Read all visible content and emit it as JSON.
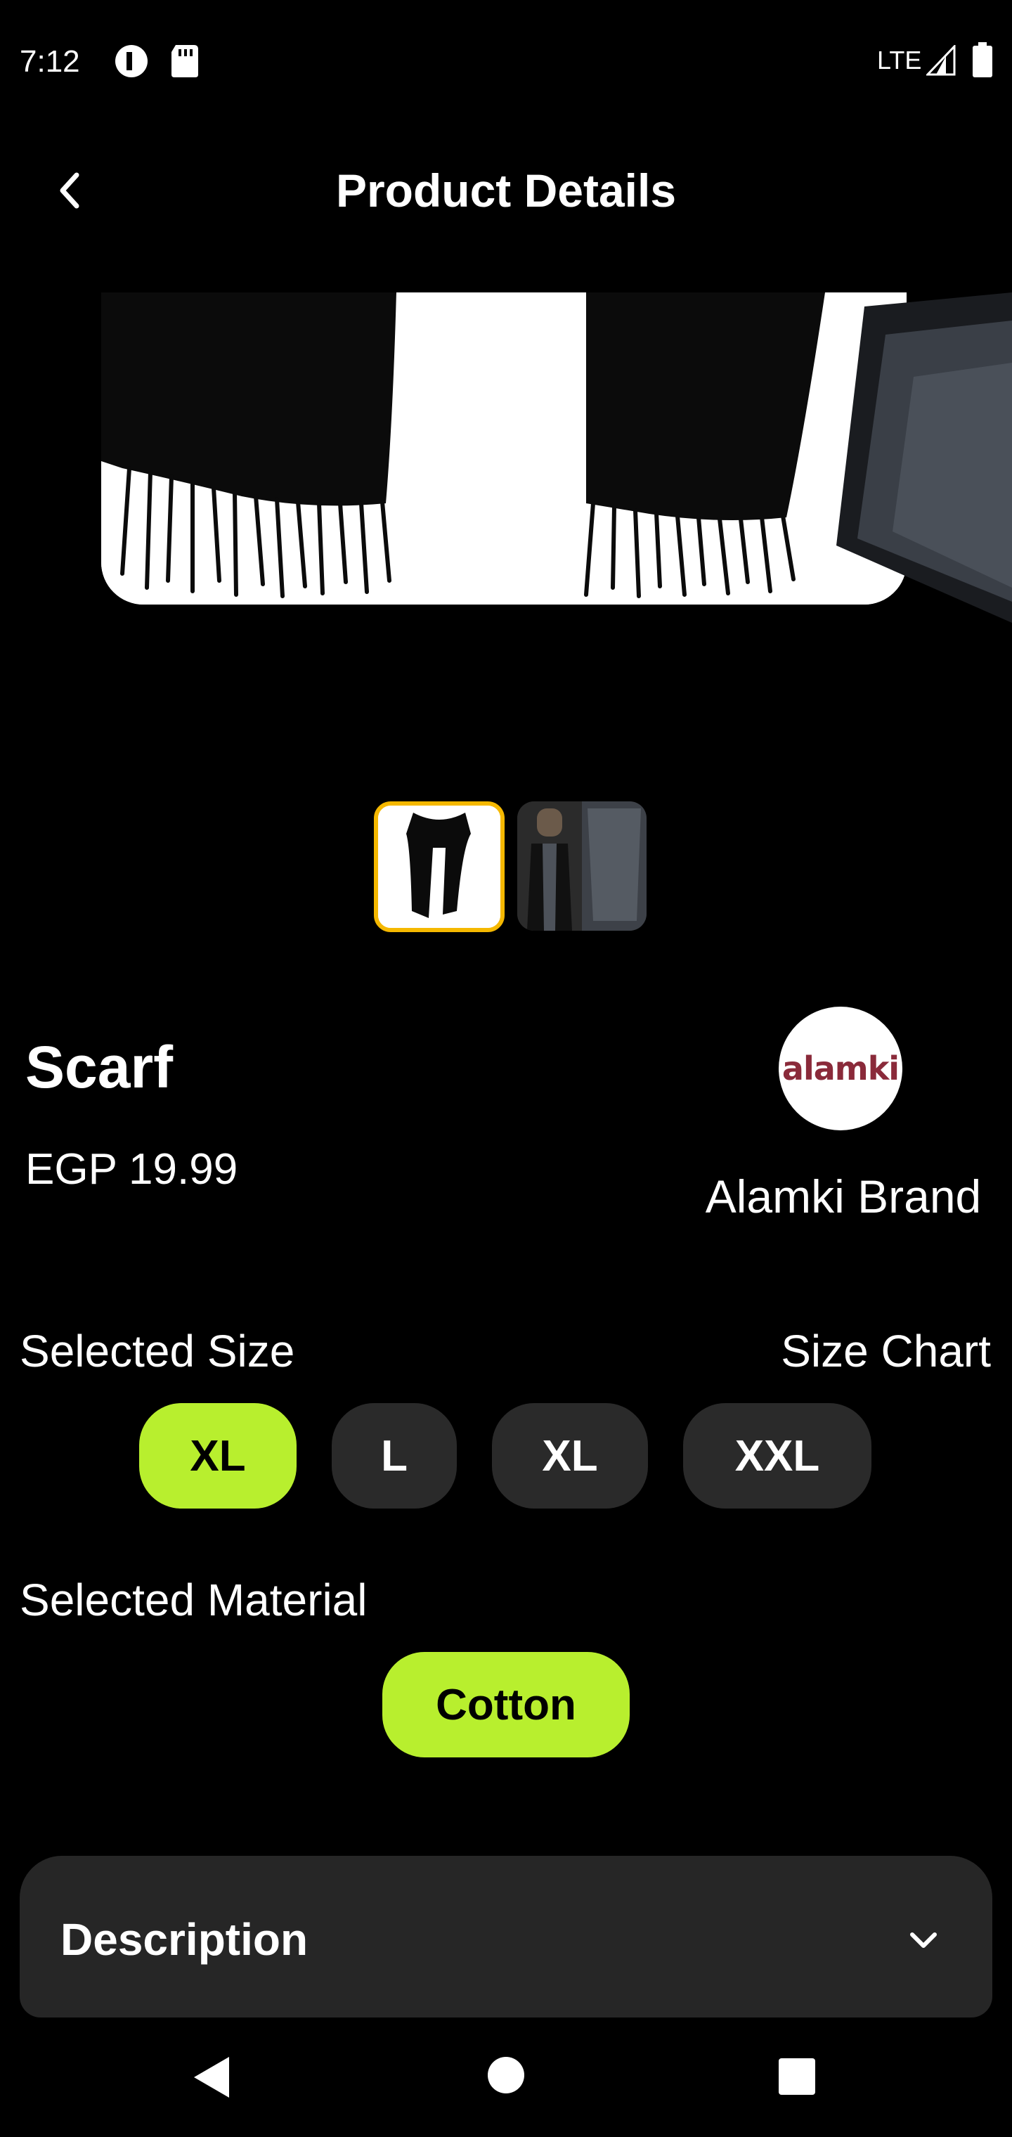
{
  "status_bar": {
    "time": "7:12",
    "network": "LTE",
    "icons": [
      "circle-notification-icon",
      "sd-card-icon",
      "signal-icon",
      "battery-icon"
    ]
  },
  "header": {
    "title": "Product Details",
    "back_icon": "chevron-left-icon"
  },
  "gallery": {
    "main_image": "black scarf with fringe",
    "thumbnails": [
      "black scarf",
      "man with grey scarf"
    ],
    "selected_index": 0,
    "selected_border_color": "#f5b800"
  },
  "product": {
    "name": "Scarf",
    "price": "EGP 19.99"
  },
  "brand": {
    "logo_text": "alamki",
    "name": "Alamki Brand"
  },
  "sizes": {
    "label": "Selected Size",
    "chart_link": "Size Chart",
    "options": [
      "XL",
      "L",
      "XL",
      "XXL"
    ],
    "selected_index": 0
  },
  "material": {
    "label": "Selected Material",
    "options": [
      "Cotton"
    ],
    "selected_index": 0
  },
  "description": {
    "title": "Description",
    "icon": "chevron-down-icon"
  },
  "colors": {
    "accent": "#b8ef2e",
    "chip_bg": "#2a2a2a",
    "card_bg": "#262626"
  },
  "nav_bar": {
    "icons": [
      "back-triangle-icon",
      "home-circle-icon",
      "recents-square-icon"
    ]
  }
}
